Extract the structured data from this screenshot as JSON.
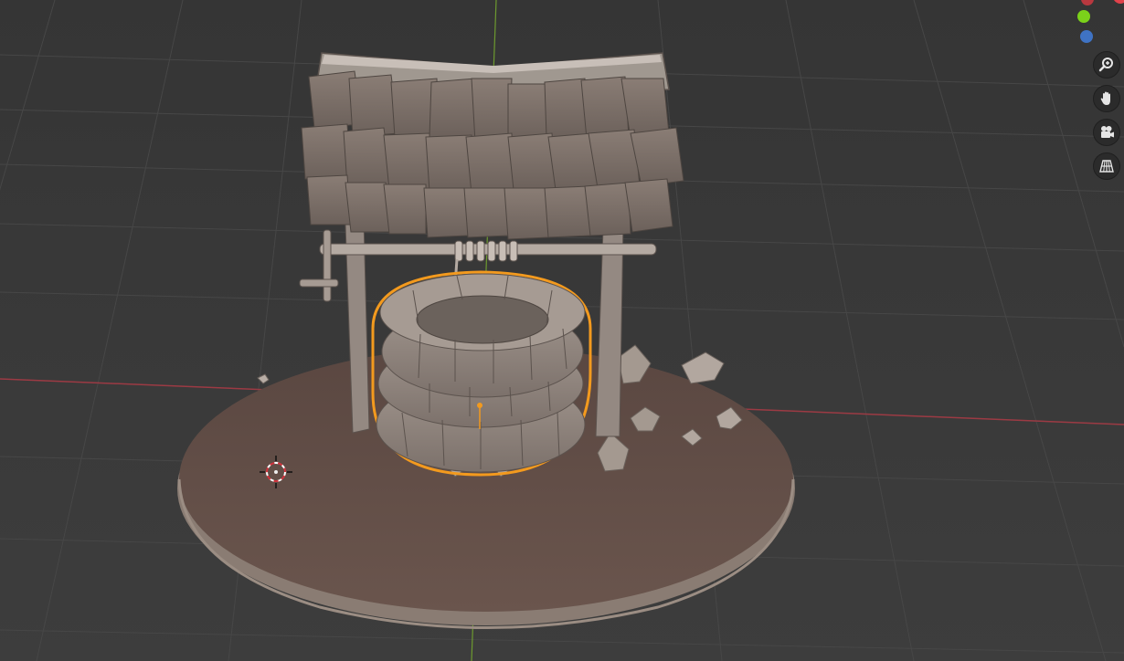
{
  "viewport": {
    "colors": {
      "background": "#3a3a3a",
      "grid_line": "#474747",
      "x_axis": "#9c3a44",
      "y_axis": "#6d9a2f",
      "ground": "#5e4b45",
      "ground_edge": "#8a7c73",
      "stone": "#8b8079",
      "stone_light": "#a69b93",
      "stone_dark": "#6b625c",
      "roof_tile": "#7e716a",
      "wood": "#948982",
      "selection": "#f39a1e"
    },
    "selected_object": "well-ring",
    "cursor_icon": "3d-cursor-icon"
  },
  "nav_gizmo": {
    "axis_colors": {
      "x": "#e2424b",
      "y": "#7bd11a",
      "z": "#3f73c4"
    }
  },
  "tools": [
    {
      "name": "zoom-icon",
      "glyph": "zoom"
    },
    {
      "name": "hand-pan-icon",
      "glyph": "hand"
    },
    {
      "name": "camera-icon",
      "glyph": "camera"
    },
    {
      "name": "grid-ortho-icon",
      "glyph": "grid"
    }
  ]
}
